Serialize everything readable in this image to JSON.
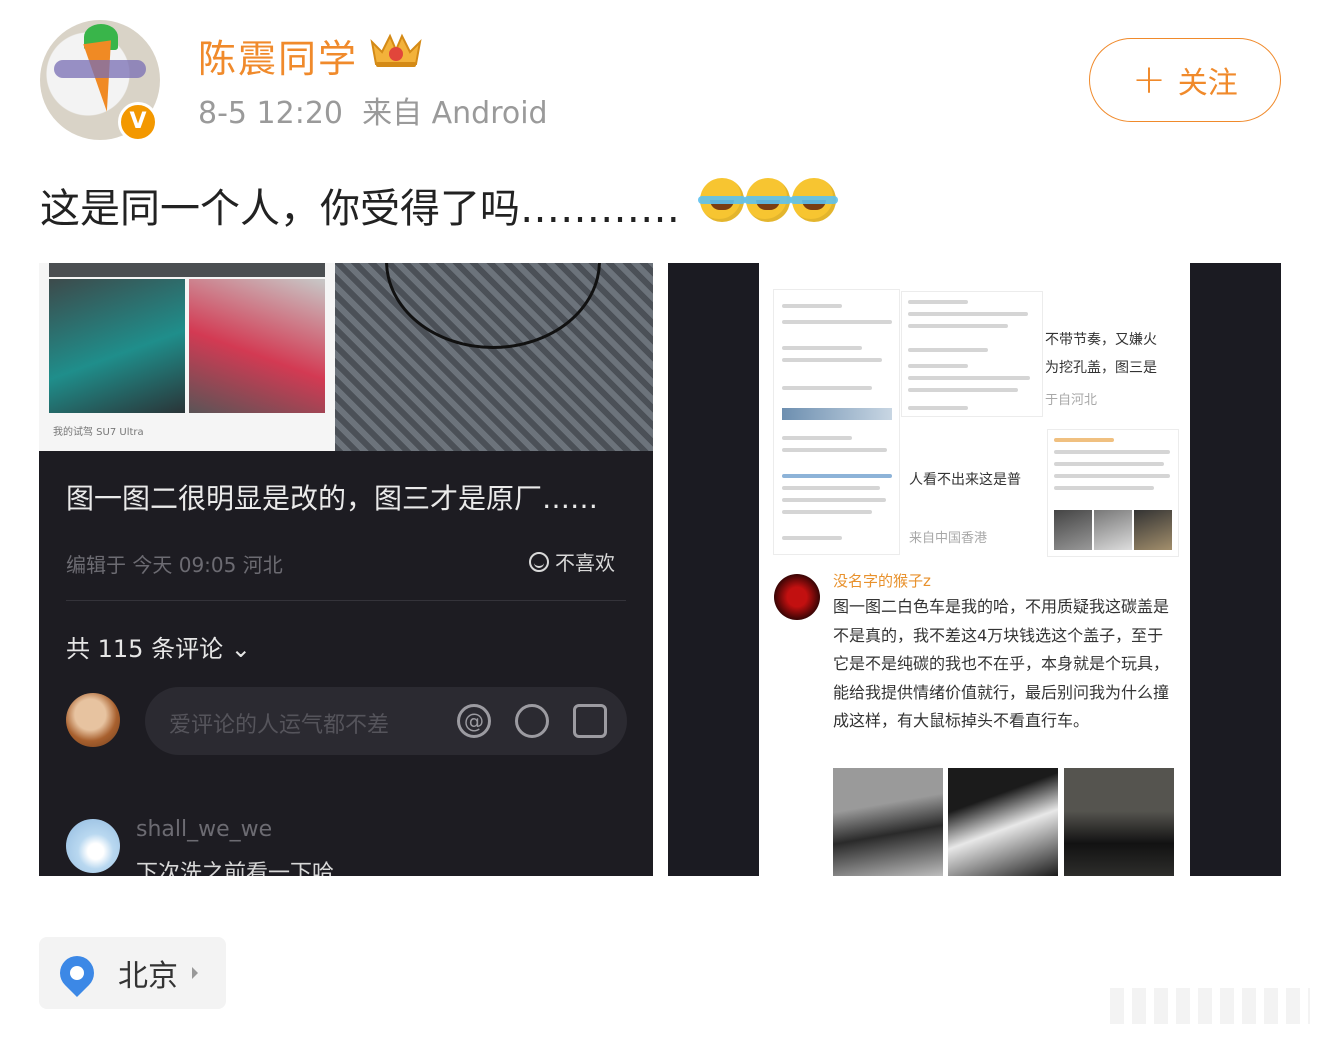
{
  "user": {
    "name": "陈震同学",
    "time": "8-5 12:20",
    "source": "来自 Android",
    "verified_badge": "V",
    "follow_label": "关注",
    "follow_plus": "+"
  },
  "post": {
    "text": "这是同一个人，你受得了吗…………",
    "emoji": "laugh-cry-emoji"
  },
  "image1": {
    "watermark": "我的试驾 SU7 Ultra",
    "title": "图一图二很明显是改的，图三才是原厂……",
    "edited": "编辑于 今天 09:05 河北",
    "dislike_label": "不喜欢",
    "comment_count": "共 115 条评论",
    "comment_count_chevron": "⌄",
    "input_placeholder": "爱评论的人运气都不差",
    "at_symbol": "@",
    "reply_name": "shall_we_we",
    "reply_text": "下次洗之前看一下哈"
  },
  "image2": {
    "snippet1": "不带节奏，又嫌火",
    "snippet2": "为挖孔盖，图三是",
    "snippet3": "于自河北",
    "snippet4": "人看不出来这是普",
    "snippet5": "来自中国香港",
    "reply_name": "没名字的猴子z",
    "reply_body": "图一图二白色车是我的哈，不用质疑我这碳盖是不是真的，我不差这4万块钱选这个盖子，至于它是不是纯碳的我也不在乎，本身就是个玩具，能给我提供情绪价值就行，最后别问我为什么撞成这样，有大鼠标掉头不看直行车。"
  },
  "location": {
    "label": "北京"
  },
  "colors": {
    "accent": "#f08a2b",
    "dark_panel": "#1d1c22",
    "pin": "#3c88e6"
  }
}
